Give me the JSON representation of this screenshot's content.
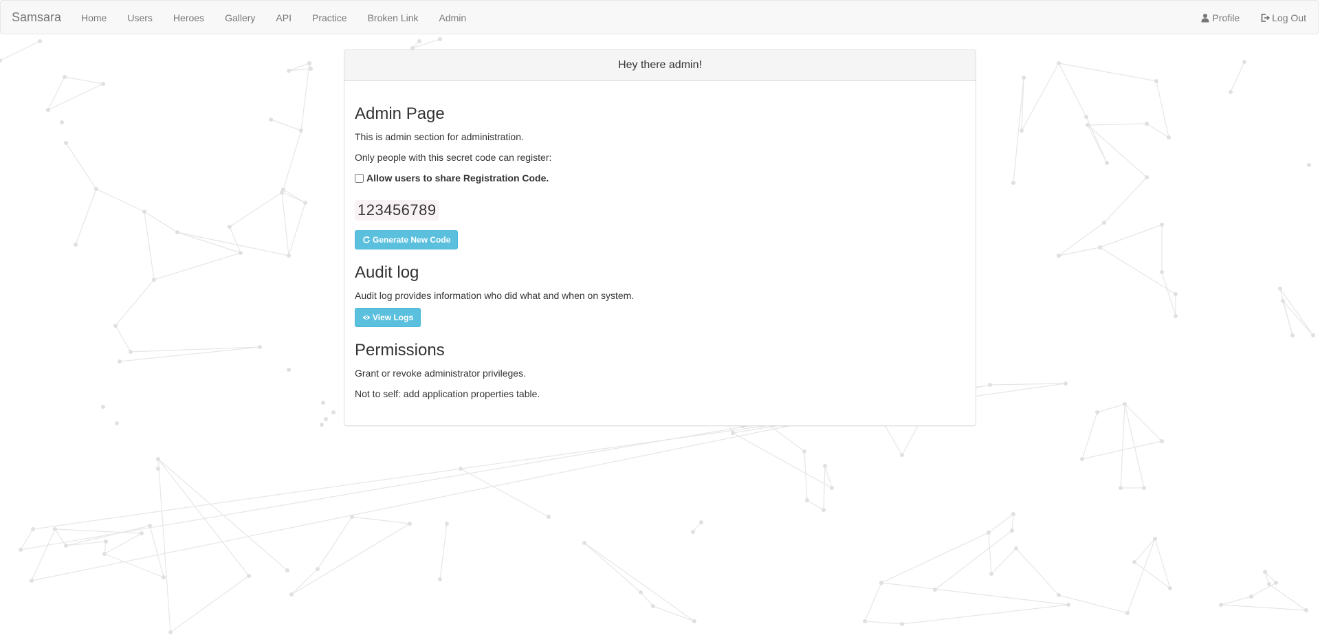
{
  "navbar": {
    "brand": "Samsara",
    "items": [
      {
        "label": "Home"
      },
      {
        "label": "Users"
      },
      {
        "label": "Heroes"
      },
      {
        "label": "Gallery"
      },
      {
        "label": "API"
      },
      {
        "label": "Practice"
      },
      {
        "label": "Broken Link"
      },
      {
        "label": "Admin"
      }
    ],
    "right": {
      "profile": {
        "label": "Profile",
        "icon": "user-icon"
      },
      "logout": {
        "label": "Log Out",
        "icon": "logout-icon"
      }
    }
  },
  "panel": {
    "heading": "Hey there admin!",
    "admin": {
      "title": "Admin Page",
      "description": "This is admin section for administration.",
      "register_note": "Only people with this secret code can register:",
      "share_checkbox_label": "Allow users to share Registration Code.",
      "share_checked": false,
      "code": "123456789",
      "generate_button": {
        "label": "Generate New Code",
        "icon": "refresh-icon"
      }
    },
    "audit": {
      "title": "Audit log",
      "description": "Audit log provides information who did what and when on system.",
      "view_button": {
        "label": "View Logs",
        "icon": "eye-icon"
      }
    },
    "permissions": {
      "title": "Permissions",
      "description": "Grant or revoke administrator privileges.",
      "note": "Not to self: add application properties table."
    }
  },
  "colors": {
    "navbar_bg": "#f8f8f8",
    "nav_text": "#777777",
    "button_info": "#5bc0de",
    "code_bg": "#f9f2f4",
    "background_network": "#e6e6e6"
  }
}
